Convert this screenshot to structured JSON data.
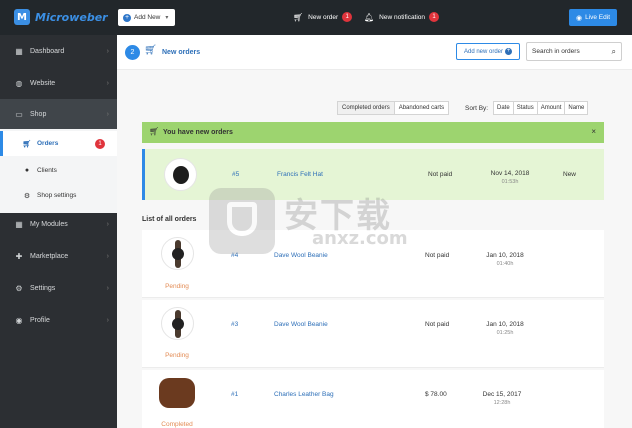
{
  "app": {
    "logo_text": "Microweber",
    "logo_letter": "M"
  },
  "topbar": {
    "add_new": "Add New",
    "new_order_label": "New order",
    "new_order_count": "1",
    "new_notification_label": "New notification",
    "new_notification_count": "1",
    "live_edit": "Live Edit"
  },
  "sidebar": {
    "items": [
      {
        "label": "Dashboard",
        "icon": "dashboard-icon"
      },
      {
        "label": "Website",
        "icon": "globe-icon"
      },
      {
        "label": "Shop",
        "icon": "shop-icon"
      },
      {
        "label": "My Modules",
        "icon": "grid-icon"
      },
      {
        "label": "Marketplace",
        "icon": "puzzle-icon"
      },
      {
        "label": "Settings",
        "icon": "gear-icon"
      },
      {
        "label": "Profile",
        "icon": "user-icon"
      }
    ],
    "shop_sub": [
      {
        "label": "Orders",
        "badge": "1"
      },
      {
        "label": "Clients"
      },
      {
        "label": "Shop settings"
      }
    ]
  },
  "header": {
    "step": "2",
    "title": "New orders",
    "add_new_order": "Add new order",
    "search_placeholder": "Search in orders"
  },
  "filters": {
    "tabs": [
      "Completed orders",
      "Abandoned carts"
    ],
    "sort_label": "Sort By:",
    "sort_options": [
      "Date",
      "Status",
      "Amount",
      "Name"
    ]
  },
  "alert": {
    "text": "You have new orders",
    "close": "×"
  },
  "new_order": {
    "number": "#5",
    "product": "Francis Felt Hat",
    "payment": "Not paid",
    "date": "Nov 14, 2018",
    "time": "01:53h",
    "status": "New"
  },
  "list_title": "List of all orders",
  "orders": [
    {
      "number": "#4",
      "product": "Dave Wool Beanie",
      "payment": "Not paid",
      "date": "Jan 10, 2018",
      "time": "01:40h",
      "status": "Pending"
    },
    {
      "number": "#3",
      "product": "Dave Wool Beanie",
      "payment": "Not paid",
      "date": "Jan 10, 2018",
      "time": "01:25h",
      "status": "Pending"
    },
    {
      "number": "#1",
      "product": "Charles Leather Bag",
      "payment": "$ 78.00",
      "date": "Dec 15, 2017",
      "time": "12:28h",
      "status": "Completed"
    }
  ],
  "watermark": {
    "zh": "安下载",
    "en": "anxz.com"
  },
  "colors": {
    "accent": "#2d8ae6",
    "sidebar": "#2c2f33",
    "alert": "#9dd46f",
    "pending": "#e38c55",
    "badge": "#e0343c"
  }
}
